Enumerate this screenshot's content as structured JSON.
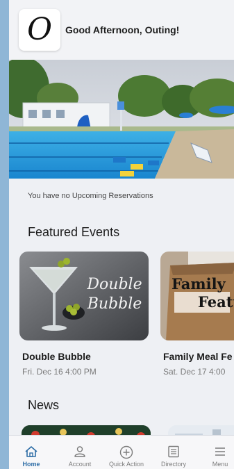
{
  "header": {
    "logo_letter": "O",
    "greeting": "Good Afternoon, Outing!"
  },
  "reservations": {
    "message": "You have no Upcoming Reservations"
  },
  "featured_events": {
    "title": "Featured Events",
    "items": [
      {
        "name": "Double Bubble",
        "date": "Fri. Dec 16 4:00 PM",
        "image_text": [
          "Double",
          "Bubble"
        ]
      },
      {
        "name": "Family Meal Fe",
        "date": "Sat. Dec 17 4:00",
        "image_text": [
          "Family",
          "Featu"
        ]
      }
    ]
  },
  "news": {
    "title": "News"
  },
  "tabbar": {
    "items": [
      {
        "label": "Home",
        "icon": "home-icon",
        "active": true
      },
      {
        "label": "Account",
        "icon": "person-icon",
        "active": false
      },
      {
        "label": "Quick Action",
        "icon": "plus-circle-icon",
        "active": false
      },
      {
        "label": "Directory",
        "icon": "list-icon",
        "active": false
      },
      {
        "label": "Menu",
        "icon": "hamburger-icon",
        "active": false
      }
    ]
  },
  "colors": {
    "accent": "#2d6da6",
    "background": "#eef0f4",
    "outer_background": "#8fb6d6"
  }
}
